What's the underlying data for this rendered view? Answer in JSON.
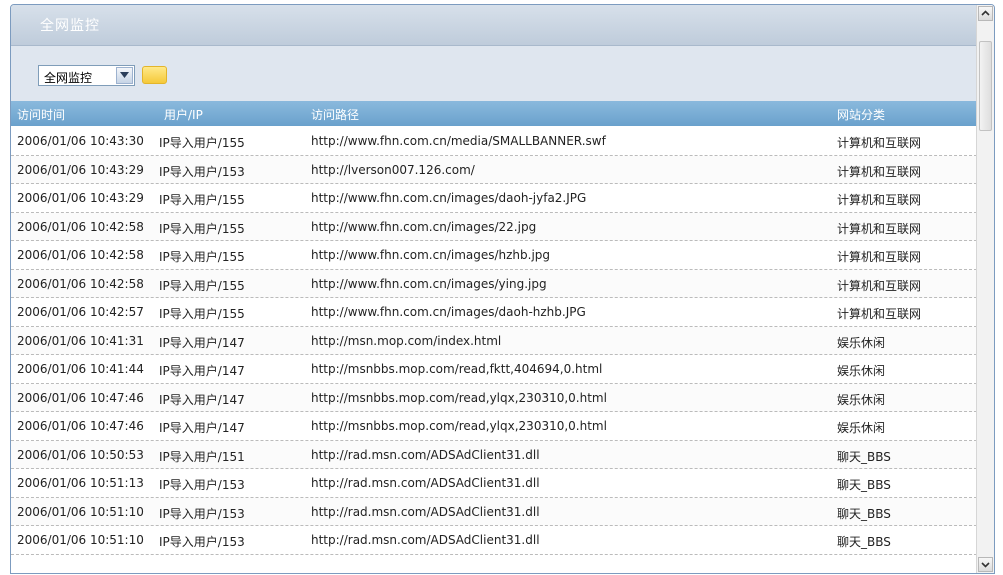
{
  "panel": {
    "title": "全网监控"
  },
  "filter": {
    "selected": "全网监控"
  },
  "table": {
    "columns": [
      "访问时间",
      "用户/IP",
      "访问路径",
      "网站分类"
    ],
    "rows": [
      [
        "2006/01/06 10:43:30",
        "IP导入用户/155",
        "http://www.fhn.com.cn/media/SMALLBANNER.swf",
        "计算机和互联网"
      ],
      [
        "2006/01/06 10:43:29",
        "IP导入用户/153",
        "http://lverson007.126.com/",
        "计算机和互联网"
      ],
      [
        "2006/01/06 10:43:29",
        "IP导入用户/155",
        "http://www.fhn.com.cn/images/daoh-jyfa2.JPG",
        "计算机和互联网"
      ],
      [
        "2006/01/06 10:42:58",
        "IP导入用户/155",
        "http://www.fhn.com.cn/images/22.jpg",
        "计算机和互联网"
      ],
      [
        "2006/01/06 10:42:58",
        "IP导入用户/155",
        "http://www.fhn.com.cn/images/hzhb.jpg",
        "计算机和互联网"
      ],
      [
        "2006/01/06 10:42:58",
        "IP导入用户/155",
        "http://www.fhn.com.cn/images/ying.jpg",
        "计算机和互联网"
      ],
      [
        "2006/01/06 10:42:57",
        "IP导入用户/155",
        "http://www.fhn.com.cn/images/daoh-hzhb.JPG",
        "计算机和互联网"
      ],
      [
        "2006/01/06 10:41:31",
        "IP导入用户/147",
        "http://msn.mop.com/index.html",
        "娱乐休闲"
      ],
      [
        "2006/01/06 10:41:44",
        "IP导入用户/147",
        "http://msnbbs.mop.com/read,fktt,404694,0.html",
        "娱乐休闲"
      ],
      [
        "2006/01/06 10:47:46",
        "IP导入用户/147",
        "http://msnbbs.mop.com/read,ylqx,230310,0.html",
        "娱乐休闲"
      ],
      [
        "2006/01/06 10:47:46",
        "IP导入用户/147",
        "http://msnbbs.mop.com/read,ylqx,230310,0.html",
        "娱乐休闲"
      ],
      [
        "2006/01/06 10:50:53",
        "IP导入用户/151",
        "http://rad.msn.com/ADSAdClient31.dll",
        "聊天_BBS"
      ],
      [
        "2006/01/06 10:51:13",
        "IP导入用户/153",
        "http://rad.msn.com/ADSAdClient31.dll",
        "聊天_BBS"
      ],
      [
        "2006/01/06 10:51:10",
        "IP导入用户/153",
        "http://rad.msn.com/ADSAdClient31.dll",
        "聊天_BBS"
      ],
      [
        "2006/01/06 10:51:10",
        "IP导入用户/153",
        "http://rad.msn.com/ADSAdClient31.dll",
        "聊天_BBS"
      ]
    ]
  },
  "icons": {
    "select_arrow": "chevron-down-icon",
    "scroll_up": "arrow-up-icon",
    "scroll_down": "arrow-down-icon"
  },
  "colors": {
    "header_blue": "#7aaed6",
    "toolbar_bg": "#dfe6ef",
    "button_yellow": "#f5c93a"
  }
}
